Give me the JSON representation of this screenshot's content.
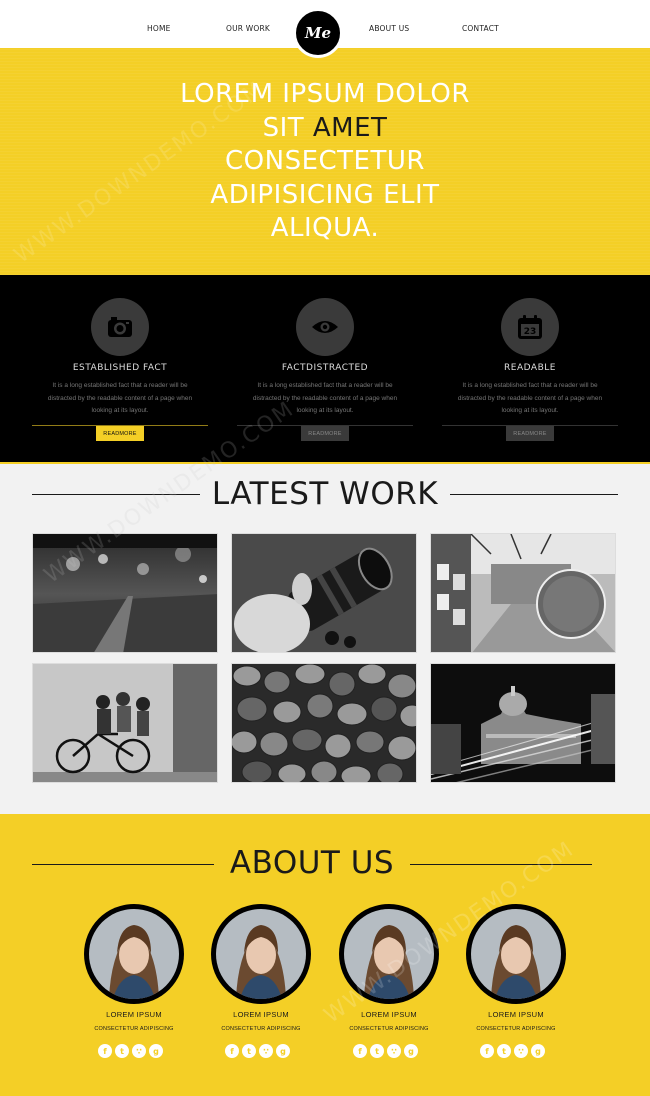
{
  "nav": {
    "items": [
      {
        "label": "HOME"
      },
      {
        "label": "OUR WORK"
      },
      {
        "label": "ABOUT US"
      },
      {
        "label": "CONTACT"
      }
    ],
    "logo_text": "Me"
  },
  "hero": {
    "line1": "LOREM IPSUM DOLOR",
    "line2a": "SIT ",
    "line2b": "AMET",
    "line3": "CONSECTETUR",
    "line4": "ADIPISICING ELIT",
    "line5": "ALIQUA."
  },
  "features": [
    {
      "icon": "camera-icon",
      "title": "ESTABLISHED FACT",
      "text": "It is a long established fact that a reader will be distracted by the readable content of a page when looking at its layout.",
      "button": "READMORE"
    },
    {
      "icon": "eye-icon",
      "title": "FACTDISTRACTED",
      "text": "It is a long established fact that a reader will be distracted by the readable content of a page when looking at its layout.",
      "button": "READMORE"
    },
    {
      "icon": "calendar-icon",
      "title": "READABLE",
      "text": "It is a long established fact that a reader will be distracted by the readable content of a page when looking at its layout.",
      "button": "READMORE",
      "calendar_day": "23"
    }
  ],
  "work": {
    "title": "LATEST WORK"
  },
  "about": {
    "title": "ABOUT US",
    "members": [
      {
        "name": "LOREM IPSUM",
        "role": "CONSECTETUR ADIPISCING"
      },
      {
        "name": "LOREM IPSUM",
        "role": "CONSECTETUR ADIPISCING"
      },
      {
        "name": "LOREM IPSUM",
        "role": "CONSECTETUR ADIPISCING"
      },
      {
        "name": "LOREM IPSUM",
        "role": "CONSECTETUR ADIPISCING"
      }
    ],
    "social_icons": [
      "facebook-icon",
      "twitter-icon",
      "rss-icon",
      "google-plus-icon"
    ]
  },
  "watermark": "WWW.DOWNDEMO.COM",
  "colors": {
    "accent_yellow": "#f4cf26",
    "dark": "#000000",
    "light_bg": "#f2f2f2"
  }
}
